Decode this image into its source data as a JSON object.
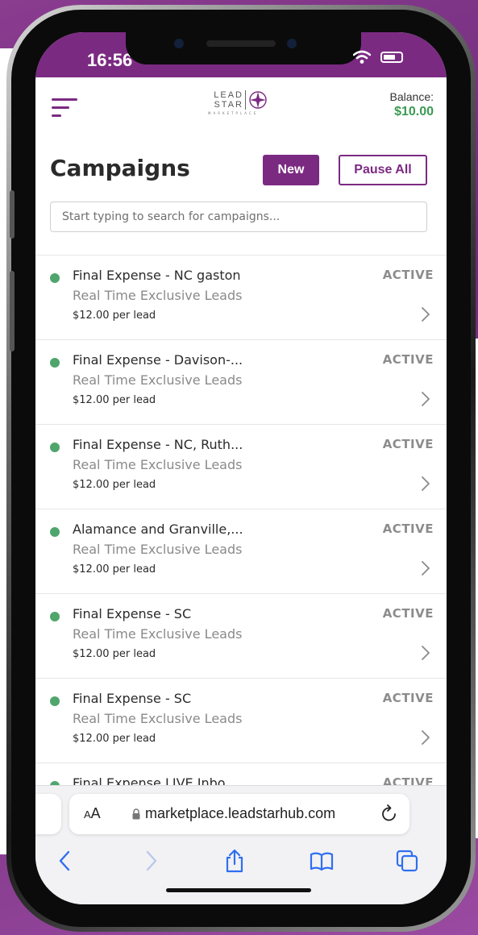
{
  "status_bar": {
    "time": "16:56"
  },
  "header": {
    "logo_line1": "LEAD",
    "logo_line2": "STAR",
    "logo_sub": "MARKETPLACE",
    "balance_label": "Balance:",
    "balance_value": "$10.00"
  },
  "page": {
    "title": "Campaigns",
    "new_label": "New",
    "pause_all_label": "Pause All",
    "search_placeholder": "Start typing to search for campaigns..."
  },
  "campaigns": [
    {
      "name": "Final Expense - NC gaston",
      "type": "Real Time Exclusive Leads",
      "price": "$12.00 per lead",
      "status": "ACTIVE"
    },
    {
      "name": "Final Expense - Davison-...",
      "type": "Real Time Exclusive Leads",
      "price": "$12.00 per lead",
      "status": "ACTIVE"
    },
    {
      "name": "Final Expense - NC, Ruth...",
      "type": "Real Time Exclusive Leads",
      "price": "$12.00 per lead",
      "status": "ACTIVE"
    },
    {
      "name": "Alamance and Granville,...",
      "type": "Real Time Exclusive Leads",
      "price": "$12.00 per lead",
      "status": "ACTIVE"
    },
    {
      "name": "Final Expense - SC",
      "type": "Real Time Exclusive Leads",
      "price": "$12.00 per lead",
      "status": "ACTIVE"
    },
    {
      "name": "Final Expense - SC",
      "type": "Real Time Exclusive Leads",
      "price": "$12.00 per lead",
      "status": "ACTIVE"
    },
    {
      "name": "Final Expense LIVE Inbo...",
      "type": "",
      "price": "",
      "status": "ACTIVE"
    }
  ],
  "browser": {
    "text_size_label": "AA",
    "url": "marketplace.leadstarhub.com"
  },
  "colors": {
    "brand_purple": "#7b2a82",
    "balance_green": "#3a9a52",
    "active_dot": "#4fa56b"
  },
  "icons": {
    "menu": "hamburger-menu-icon",
    "logo": "compass-star-icon",
    "chevron": "chevron-right-icon",
    "lock": "lock-icon",
    "reload": "reload-icon",
    "back": "back-arrow-icon",
    "forward": "forward-arrow-icon",
    "share": "share-icon",
    "bookmarks": "bookmarks-icon",
    "tabs": "tabs-icon"
  }
}
